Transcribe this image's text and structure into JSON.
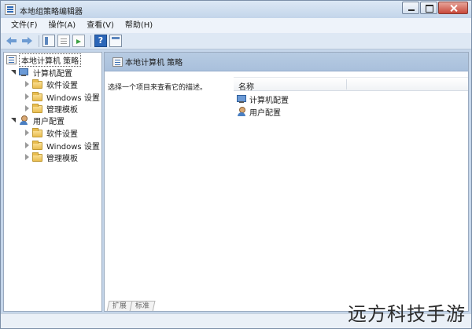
{
  "window": {
    "title": "本地组策略编辑器"
  },
  "menu": [
    "文件(F)",
    "操作(A)",
    "查看(V)",
    "帮助(H)"
  ],
  "toolbar": {
    "icons": [
      "back-arrow-icon",
      "forward-arrow-icon",
      "show-hide-tree-icon",
      "properties-icon",
      "export-list-icon",
      "help-icon",
      "show-hide-action-pane-icon"
    ],
    "help_glyph": "?"
  },
  "tree": {
    "root": "本地计算机 策略",
    "computer_config": {
      "label": "计算机配置",
      "children": [
        "软件设置",
        "Windows 设置",
        "管理模板"
      ]
    },
    "user_config": {
      "label": "用户配置",
      "children": [
        "软件设置",
        "Windows 设置",
        "管理模板"
      ]
    }
  },
  "details": {
    "header": "本地计算机 策略",
    "description": "选择一个项目来查看它的描述。",
    "column_name": "名称",
    "items": [
      "计算机配置",
      "用户配置"
    ],
    "tabs": [
      "扩展",
      "标准"
    ]
  },
  "watermark": "远方科技手游",
  "colors": {
    "header_blue": "#b7cbe2",
    "frame": "#c5d6ea"
  }
}
